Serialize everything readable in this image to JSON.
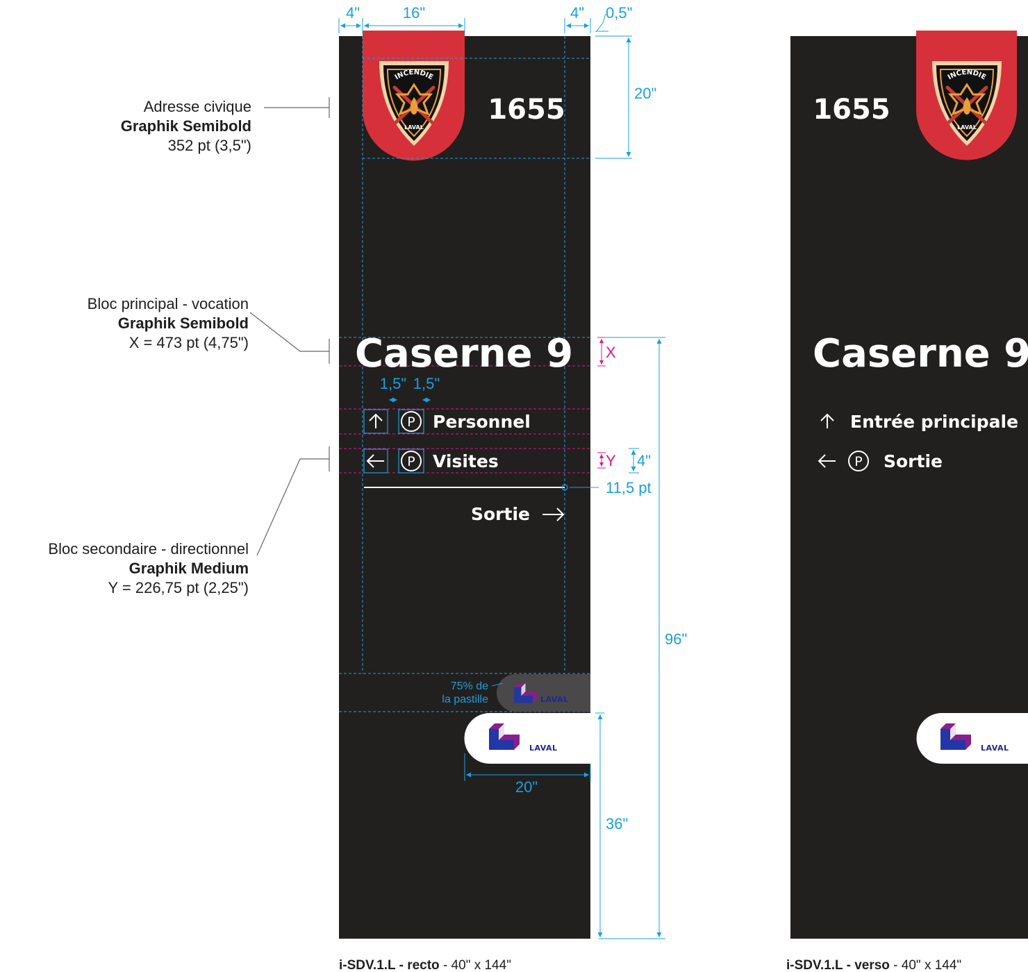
{
  "annotations": {
    "address": {
      "line1": "Adresse civique",
      "font": "Graphik Semibold",
      "size": "352 pt (3,5\")"
    },
    "main_block": {
      "line1": "Bloc principal - vocation",
      "font": "Graphik Semibold",
      "size": "X = 473 pt (4,75\")"
    },
    "secondary_block": {
      "line1": "Bloc secondaire - directionnel",
      "font": "Graphik Medium",
      "size": "Y = 226,75 pt (2,25\")"
    }
  },
  "dimensions": {
    "left_margin": "4\"",
    "badge_width": "16\"",
    "right_margin": "4\"",
    "top_offset": "0,5\"",
    "header_height": "20\"",
    "x_label": "X",
    "icon_gap_1": "1,5\"",
    "icon_gap_2": "1,5\"",
    "y_label": "Y",
    "line_height": "4\"",
    "rule_weight": "11,5 pt",
    "total_height": "96\"",
    "bottom_height": "36\"",
    "logo_width": "20\"",
    "pill_note_1": "75% de",
    "pill_note_2": "la pastille"
  },
  "recto": {
    "civic_number": "1655",
    "title": "Caserne 9",
    "directions": [
      {
        "arrow": "up-arrow",
        "parking": "P",
        "label": "Personnel"
      },
      {
        "arrow": "left-arrow",
        "parking": "P",
        "label": "Visites"
      }
    ],
    "exit": {
      "label": "Sortie",
      "arrow": "right-arrow"
    },
    "caption_bold": "i-SDV.1.L - recto",
    "caption_rest": " - 40\" x 144\""
  },
  "verso": {
    "civic_number": "1655",
    "title": "Caserne 9",
    "directions": [
      {
        "arrow": "up-arrow",
        "label": "Entrée principale"
      },
      {
        "arrow": "left-arrow",
        "parking": "P",
        "label": "Sortie"
      }
    ],
    "caption_bold": "i-SDV.1.L - verso",
    "caption_rest": " - 40\" x 144\""
  },
  "badge": {
    "top_text": "INCENDIE",
    "bottom_text": "LAVAL",
    "colors": {
      "red": "#d6313a",
      "shield": "#111111",
      "gold": "#e8a03a",
      "rim": "#f2d3a6"
    }
  },
  "logo": {
    "text": "LAVAL",
    "colors": {
      "blue": "#2336a6",
      "purple": "#8a1e8c",
      "dark": "#1e2a8c"
    }
  },
  "colors": {
    "panel": "#221f1f",
    "dimension": "#1aa0dc",
    "magenta": "#e0158a",
    "annotation": "#1e1e1e"
  }
}
